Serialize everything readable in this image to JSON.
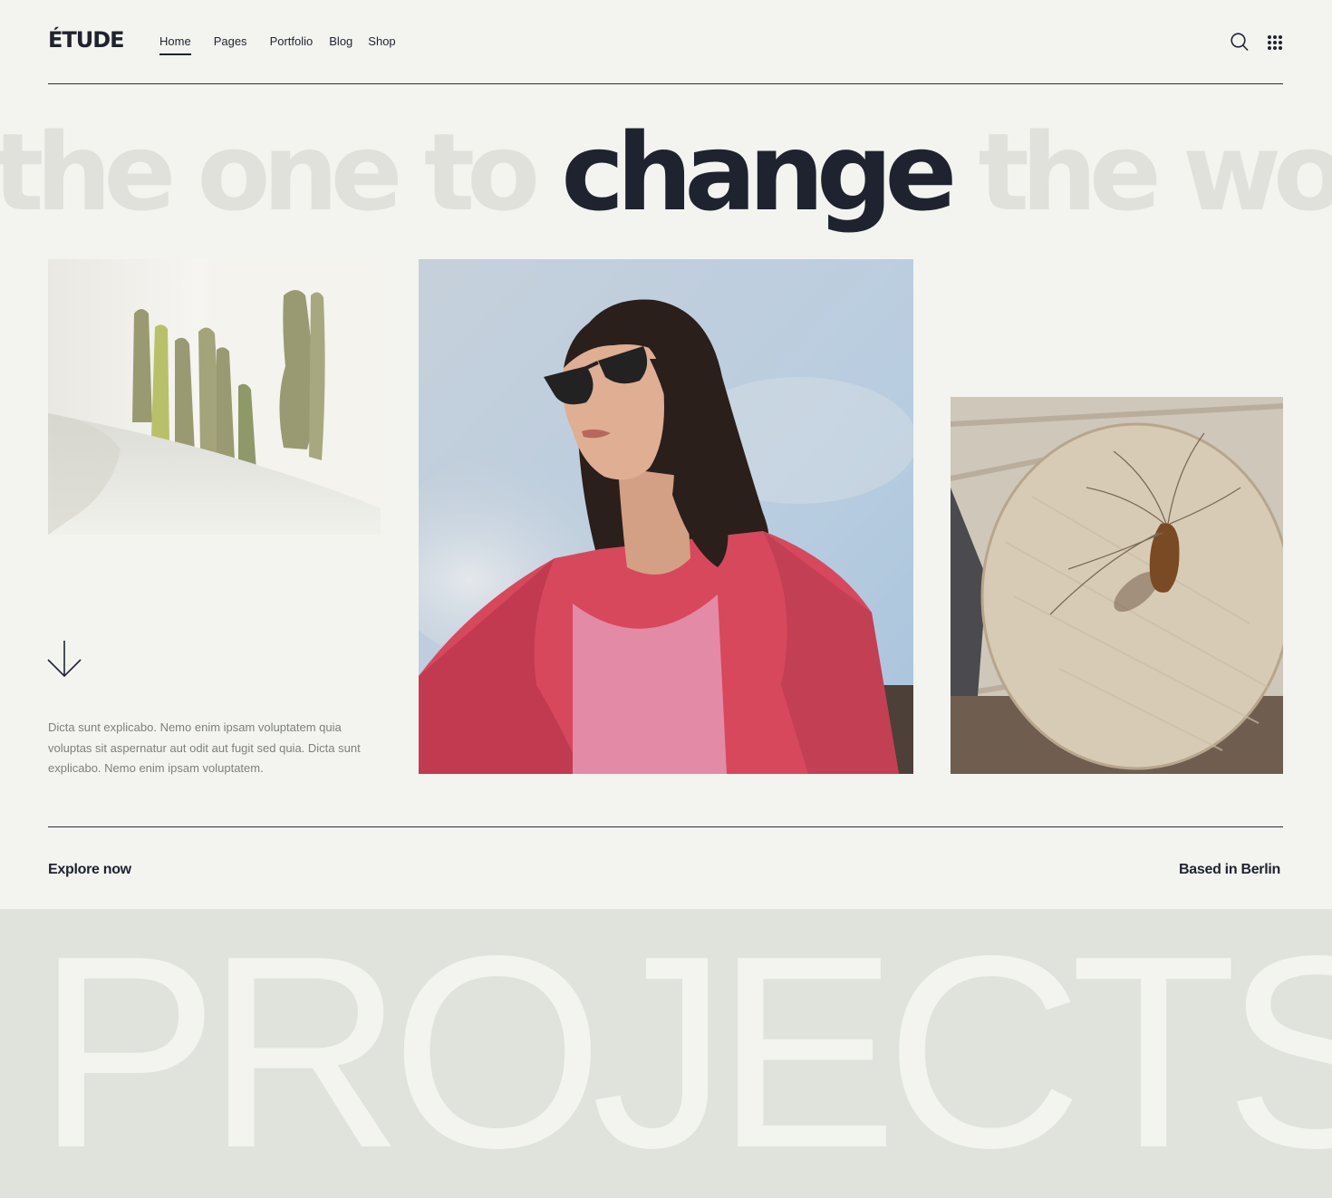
{
  "brand": {
    "logo": "ÉTUDE"
  },
  "nav": {
    "items": [
      "Home",
      "Pages",
      "Portfolio",
      "Blog",
      "Shop"
    ],
    "active": "Home"
  },
  "header_icons": [
    "search-icon",
    "grid-menu-icon"
  ],
  "hero": {
    "marquee_before": "the one to ",
    "marquee_highlight": "change",
    "marquee_after": " the world no"
  },
  "images": {
    "left": "cactus-photo",
    "center": "woman-portrait-photo",
    "right": "round-table-photo"
  },
  "intro_text": "Dicta sunt explicabo. Nemo enim ipsam voluptatem quia voluptas sit aspernatur aut odit aut fugit sed quia. Dicta sunt explicabo. Nemo enim ipsam voluptatem.",
  "footer_row": {
    "explore": "Explore now",
    "location": "Based in Berlin"
  },
  "projects": {
    "title": "PROJECTS"
  },
  "colors": {
    "background": "#f3f4f0",
    "text": "#1f2330",
    "muted_marquee": "#dfe1da",
    "band": "#e0e2dc"
  }
}
